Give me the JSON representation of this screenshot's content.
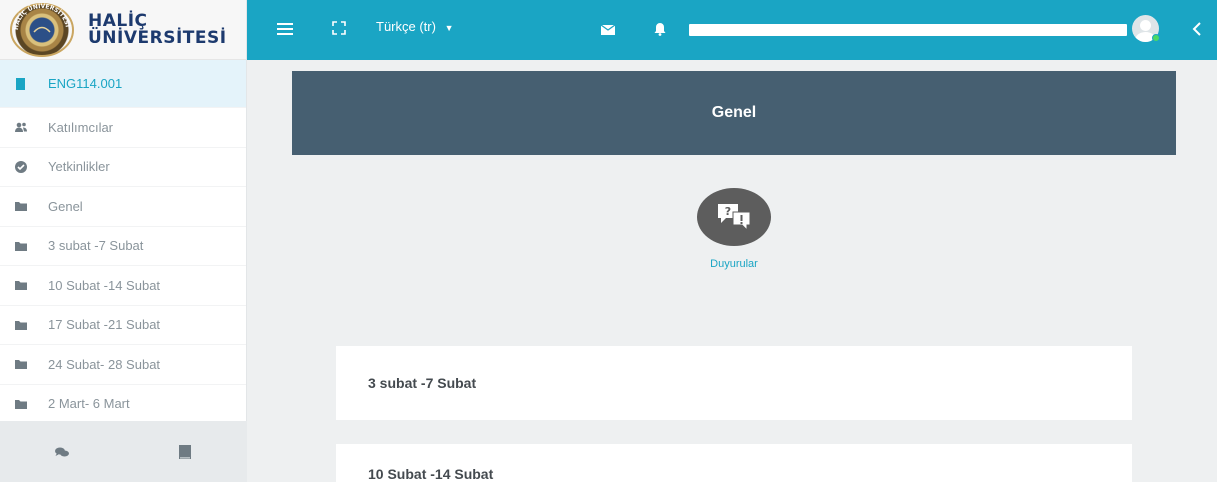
{
  "brand": {
    "line1": "HALİÇ",
    "line2": "ÜNİVERSİTESİ",
    "seal_text": "HALİÇ ÜNİVERSİTESİ",
    "color": "#1d3a6e"
  },
  "sidebar": {
    "items": [
      {
        "label": "ENG114.001",
        "icon": "book-icon",
        "active": true
      },
      {
        "label": "Katılımcılar",
        "icon": "users-icon",
        "active": false
      },
      {
        "label": "Yetkinlikler",
        "icon": "check-circle-icon",
        "active": false
      },
      {
        "label": "Genel",
        "icon": "folder-icon",
        "active": false
      },
      {
        "label": "3 subat -7 Subat",
        "icon": "folder-icon",
        "active": false
      },
      {
        "label": "10 Subat -14 Subat",
        "icon": "folder-icon",
        "active": false
      },
      {
        "label": "17 Subat -21 Subat",
        "icon": "folder-icon",
        "active": false
      },
      {
        "label": "24 Subat- 28 Subat",
        "icon": "folder-icon",
        "active": false
      },
      {
        "label": "2 Mart- 6 Mart",
        "icon": "folder-icon",
        "active": false
      }
    ],
    "footer_icons": [
      "comments-icon",
      "book-icon"
    ]
  },
  "topbar": {
    "language": "Türkçe (tr)",
    "background": "#1aa5c4"
  },
  "main": {
    "section_title": "Genel",
    "forum_label": "Duyurular",
    "cards": [
      {
        "title": "3 subat -7 Subat"
      },
      {
        "title": "10 Subat -14 Subat"
      }
    ]
  },
  "colors": {
    "accent": "#1aa5c4",
    "header_bg": "#465f71",
    "active_item_bg": "#e4f3fa"
  }
}
